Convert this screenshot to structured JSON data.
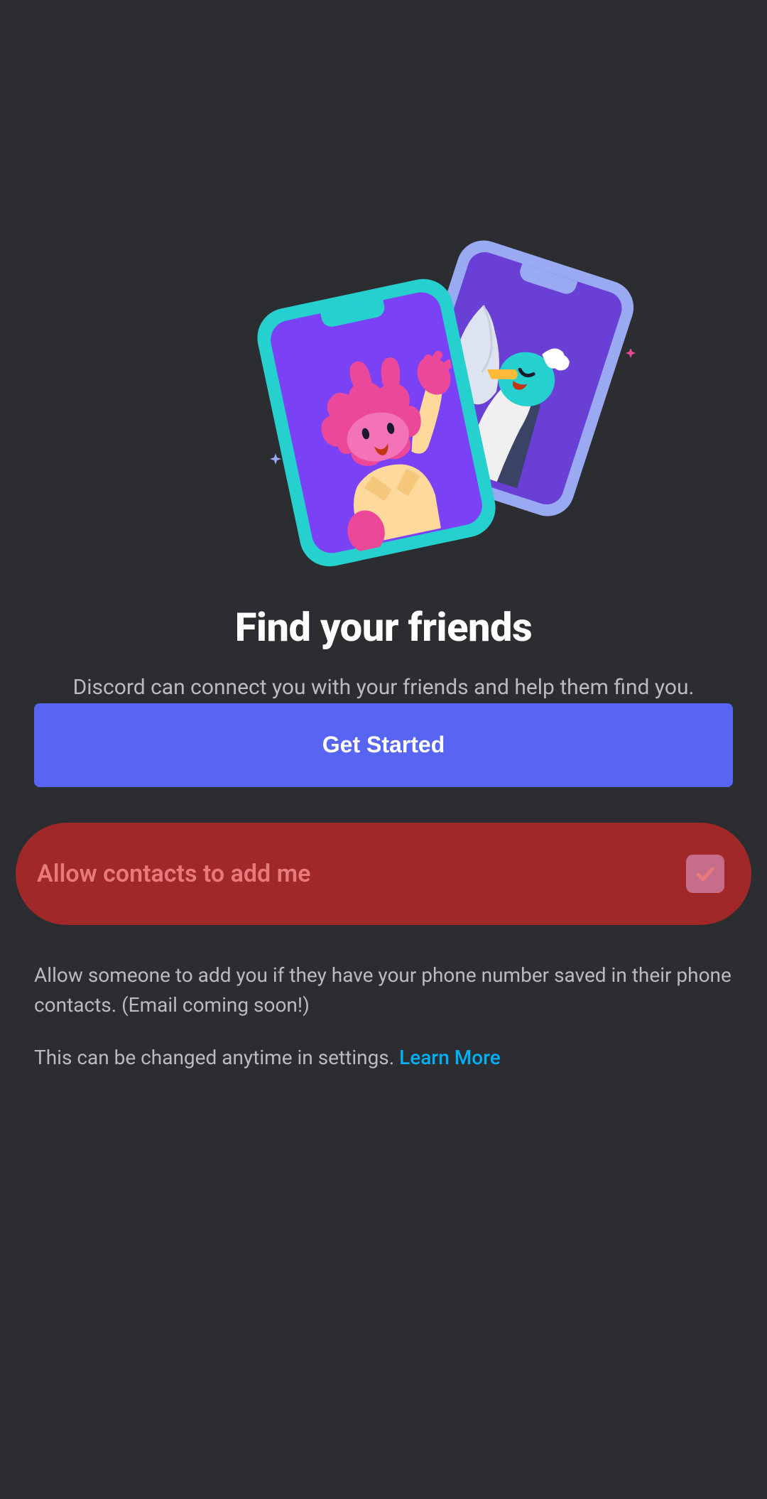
{
  "heading": "Find your friends",
  "subheading": "Discord can connect you with your friends and help them find you.",
  "primaryButton": "Get Started",
  "toggle": {
    "label": "Allow contacts to add me",
    "checked": true
  },
  "description": "Allow someone to add you if they have your phone number saved in their phone contacts. (Email coming soon!)",
  "footer": {
    "text": "This can be changed anytime in settings. ",
    "linkText": "Learn More"
  },
  "colors": {
    "primary": "#5865f2",
    "background": "#2b2d31",
    "highlight": "#a12828",
    "link": "#00aff4"
  }
}
